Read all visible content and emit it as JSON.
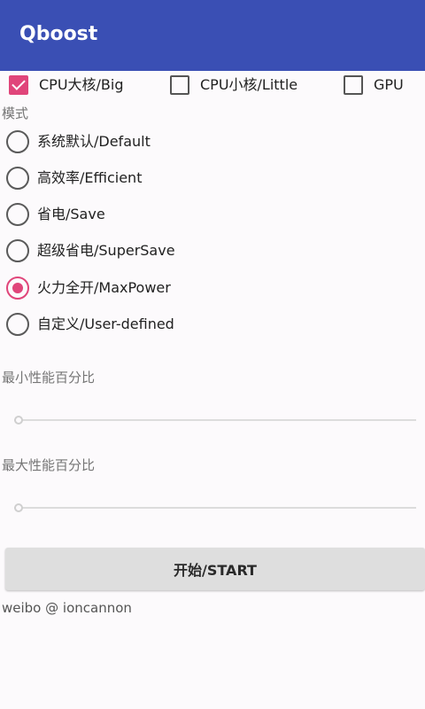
{
  "app": {
    "title": "Qboost",
    "accent_color": "#e0457a",
    "appbar_color": "#3a4fb4"
  },
  "targets": [
    {
      "label": "CPU大核/Big",
      "checked": true
    },
    {
      "label": "CPU小核/Little",
      "checked": false
    },
    {
      "label": "GPU",
      "checked": false
    }
  ],
  "mode": {
    "label": "模式",
    "options": [
      {
        "label": "系统默认/Default",
        "selected": false
      },
      {
        "label": "高效率/Efficient",
        "selected": false
      },
      {
        "label": "省电/Save",
        "selected": false
      },
      {
        "label": "超级省电/SuperSave",
        "selected": false
      },
      {
        "label": "火力全开/MaxPower",
        "selected": true
      },
      {
        "label": "自定义/User-defined",
        "selected": false
      }
    ]
  },
  "min_perf": {
    "label": "最小性能百分比",
    "value_fraction": 0
  },
  "max_perf": {
    "label": "最大性能百分比",
    "value_fraction": 0
  },
  "start_button": {
    "label": "开始/START"
  },
  "footer": {
    "text": "weibo @ ioncannon"
  }
}
